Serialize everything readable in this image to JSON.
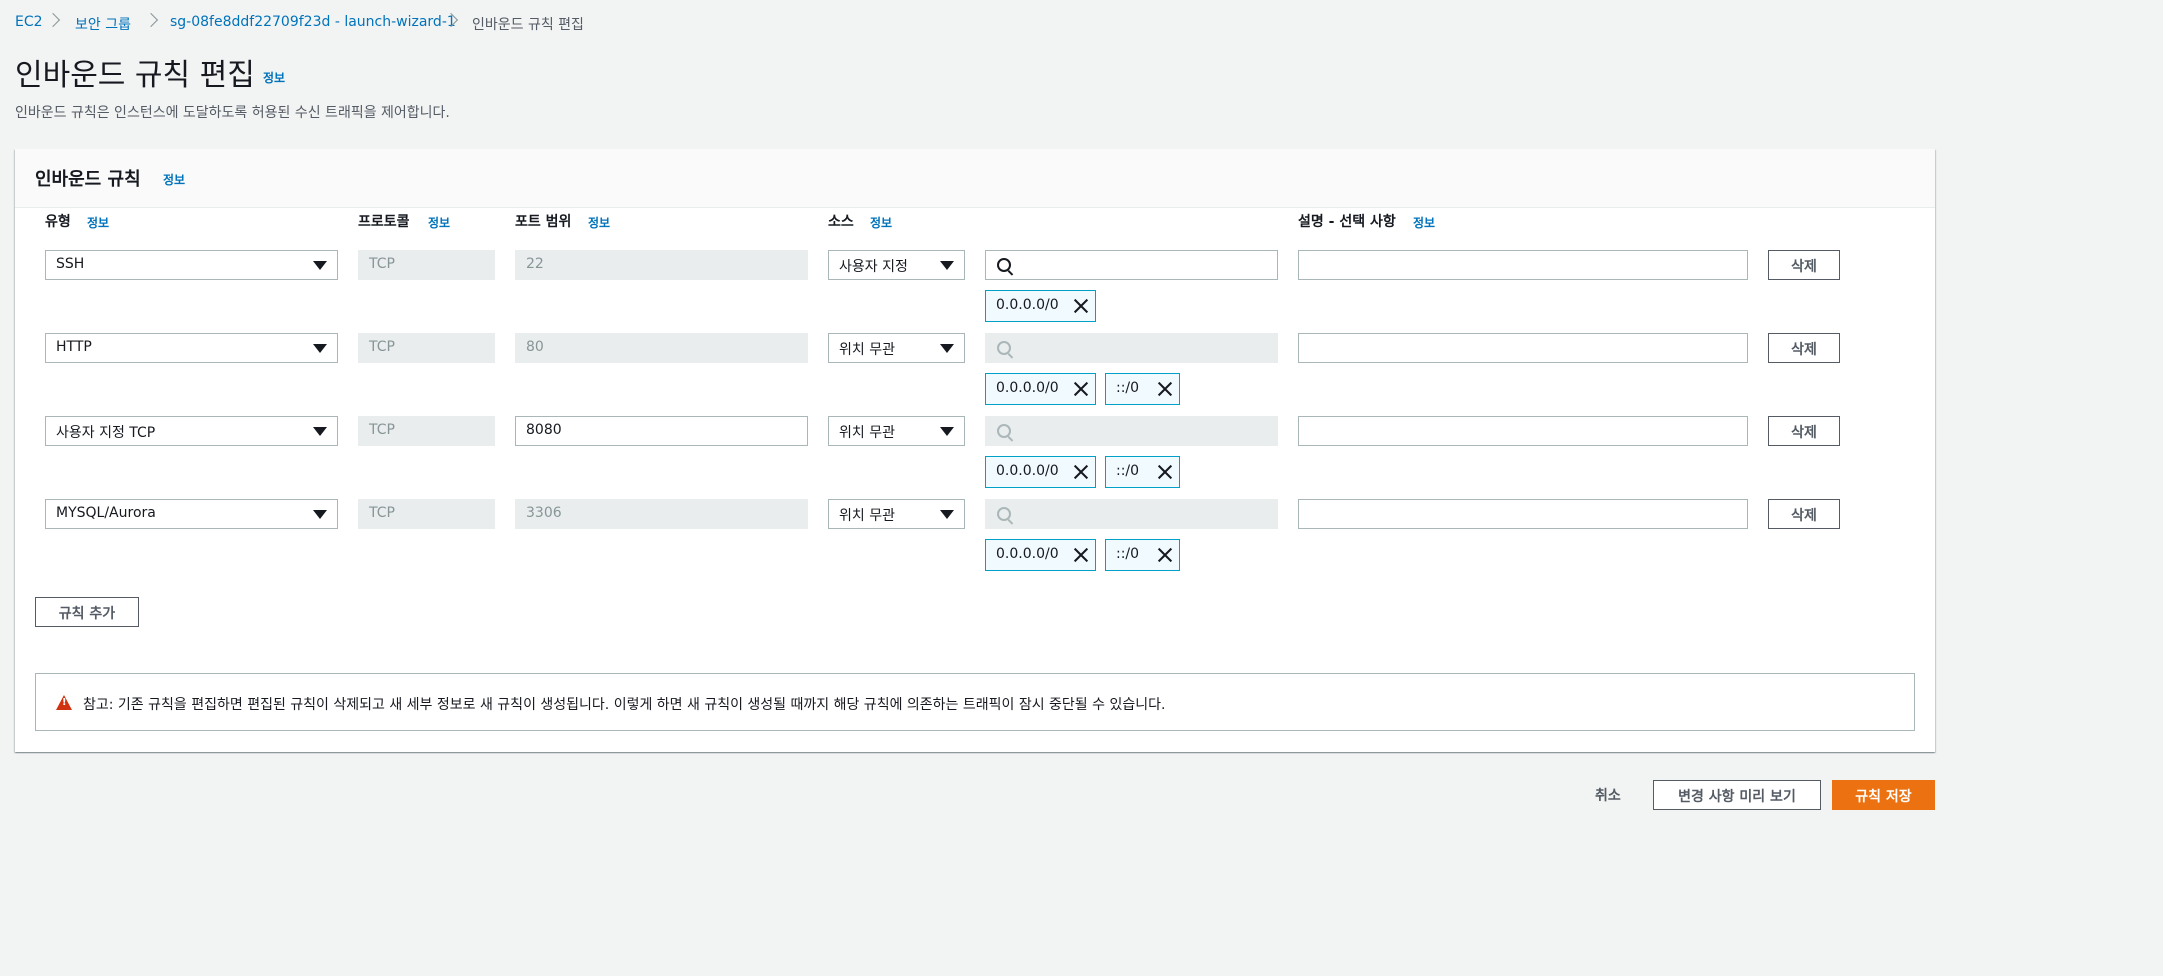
{
  "breadcrumb": {
    "items": [
      "EC2",
      "보안 그룹",
      "sg-08fe8ddf22709f23d - launch-wizard-1"
    ],
    "current": "인바운드 규칙 편집"
  },
  "page": {
    "title": "인바운드 규칙 편집",
    "info": "정보",
    "description": "인바운드 규칙은 인스턴스에 도달하도록 허용된 수신 트래픽을 제어합니다."
  },
  "panel": {
    "title": "인바운드 규칙",
    "info": "정보",
    "columns": {
      "type": "유형",
      "protocol": "프로토콜",
      "port": "포트 범위",
      "source": "소스",
      "description": "설명 - 선택 사항",
      "info": "정보"
    },
    "rules": [
      {
        "type": "SSH",
        "protocol": "TCP",
        "port": "22",
        "source": "사용자 지정",
        "search": "",
        "cidrs": [
          "0.0.0.0/0"
        ],
        "description": "",
        "delete": "삭제"
      },
      {
        "type": "HTTP",
        "protocol": "TCP",
        "port": "80",
        "source": "위치 무관",
        "search": "",
        "cidrs": [
          "0.0.0.0/0",
          "::/0"
        ],
        "description": "",
        "delete": "삭제"
      },
      {
        "type": "사용자 지정 TCP",
        "protocol": "TCP",
        "port": "8080",
        "source": "위치 무관",
        "search": "",
        "cidrs": [
          "0.0.0.0/0",
          "::/0"
        ],
        "description": "",
        "delete": "삭제"
      },
      {
        "type": "MYSQL/Aurora",
        "protocol": "TCP",
        "port": "3306",
        "source": "위치 무관",
        "search": "",
        "cidrs": [
          "0.0.0.0/0",
          "::/0"
        ],
        "description": "",
        "delete": "삭제"
      }
    ],
    "add_rule": "규칙 추가",
    "alert": "참고: 기존 규칙을 편집하면 편집된 규칙이 삭제되고 새 세부 정보로 새 규칙이 생성됩니다. 이렇게 하면 새 규칙이 생성될 때까지 해당 규칙에 의존하는 트래픽이 잠시 중단될 수 있습니다."
  },
  "footer": {
    "cancel": "취소",
    "preview": "변경 사항 미리 보기",
    "save": "규칙 저장"
  },
  "colors": {
    "accent": "#ec7211",
    "link": "#0073bb",
    "tag_border": "#00a1c9",
    "warning": "#d13212"
  }
}
